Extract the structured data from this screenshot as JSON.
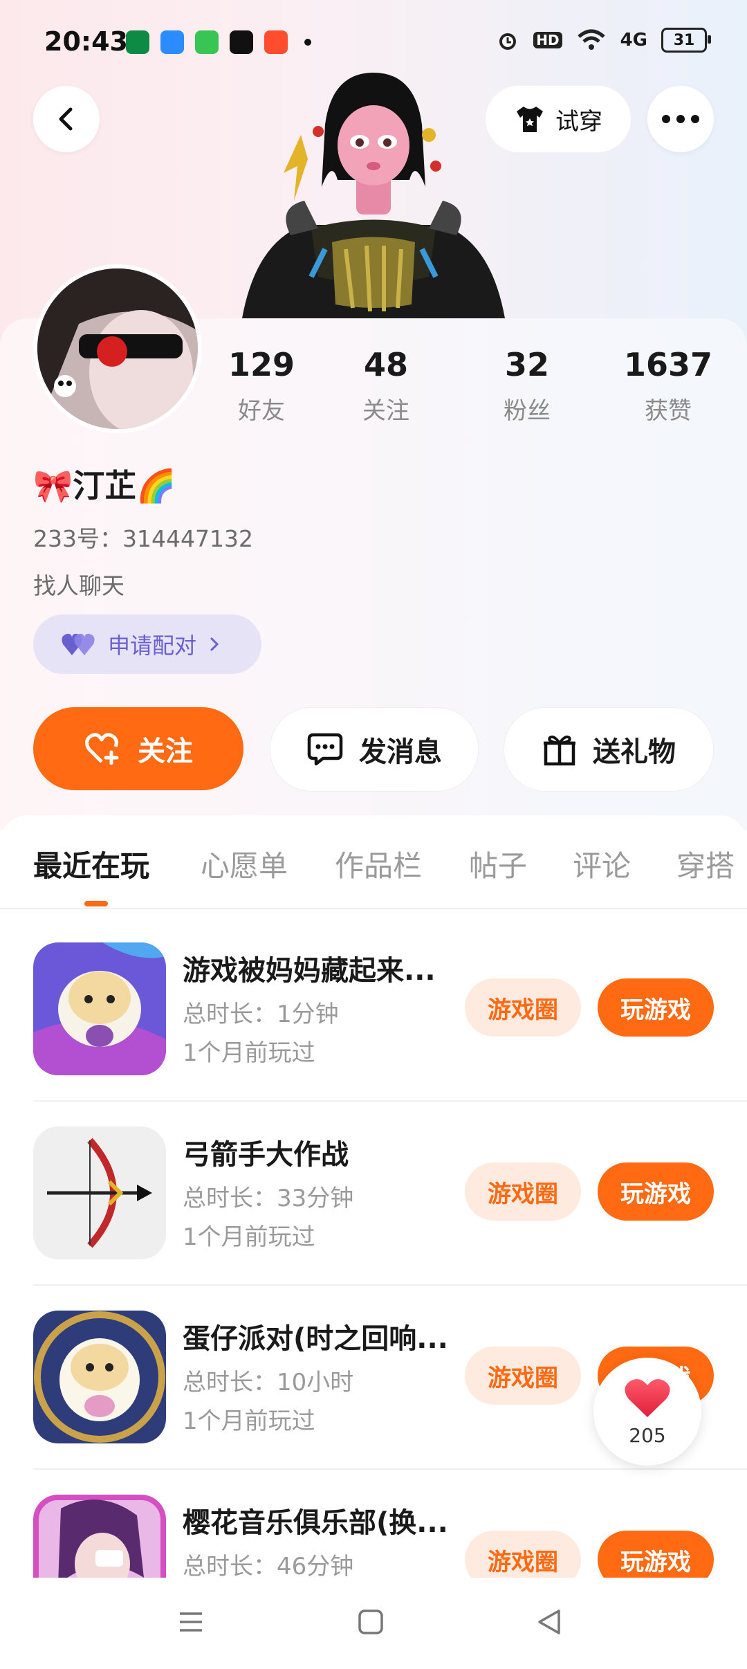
{
  "status_bar": {
    "time": "20:43",
    "battery": "31",
    "network": "4G",
    "hd": "HD"
  },
  "header": {
    "try_on_label": "试穿"
  },
  "stats": [
    {
      "value": "129",
      "label": "好友"
    },
    {
      "value": "48",
      "label": "关注"
    },
    {
      "value": "32",
      "label": "粉丝"
    },
    {
      "value": "1637",
      "label": "获赞"
    }
  ],
  "profile": {
    "name": "🎀汀芷🌈",
    "id_line": "233号：314447132",
    "bio": "找人聊天",
    "pair_label": "申请配对"
  },
  "actions": {
    "follow": "关注",
    "message": "发消息",
    "gift": "送礼物"
  },
  "tabs": [
    "最近在玩",
    "心愿单",
    "作品栏",
    "帖子",
    "评论",
    "穿搭"
  ],
  "games": [
    {
      "title": "游戏被妈妈藏起来...",
      "duration": "总时长：1分钟",
      "last_played": "1个月前玩过",
      "circle": "游戏圈",
      "play": "玩游戏"
    },
    {
      "title": "弓箭手大作战",
      "duration": "总时长：33分钟",
      "last_played": "1个月前玩过",
      "circle": "游戏圈",
      "play": "玩游戏"
    },
    {
      "title": "蛋仔派对(时之回响...",
      "duration": "总时长：10小时",
      "last_played": "1个月前玩过",
      "circle": "游戏圈",
      "play": "玩游戏"
    },
    {
      "title": "樱花音乐俱乐部(换...",
      "duration": "总时长：46分钟",
      "last_played": "",
      "circle": "游戏圈",
      "play": "玩游戏"
    }
  ],
  "like_float": {
    "count": "205"
  },
  "colors": {
    "accent": "#ff6a13",
    "accent_light": "#ffeadf",
    "pair_purple": "#6a5fd0"
  }
}
